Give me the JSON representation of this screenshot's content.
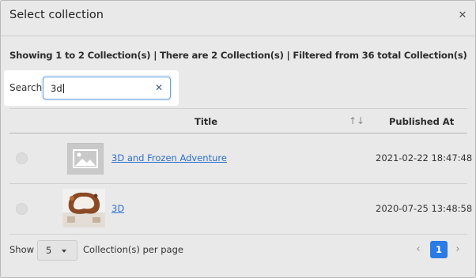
{
  "dialog": {
    "title": "Select collection",
    "close_icon": "close-icon"
  },
  "summary": "Showing 1 to 2 Collection(s) | There are 2 Collection(s) | Filtered from 36 total Collection(s)",
  "search": {
    "label": "Search:",
    "value": "3d",
    "clear_icon": "clear-icon"
  },
  "table": {
    "columns": {
      "title": "Title",
      "sort_icon": "sort-icon",
      "published_at": "Published At"
    },
    "rows": [
      {
        "thumbnail": "image-placeholder-icon",
        "title": "3D and Frozen Adventure",
        "published_at": "2021-02-22 18:47:48"
      },
      {
        "thumbnail": "collection-photo",
        "title": "3D",
        "published_at": "2020-07-25 13:48:58"
      }
    ]
  },
  "footer": {
    "show_label": "Show",
    "page_size": "5",
    "per_page_label": "Collection(s) per page",
    "current_page": "1"
  },
  "colors": {
    "accent": "#2a7be4",
    "link": "#2f6fcf"
  }
}
